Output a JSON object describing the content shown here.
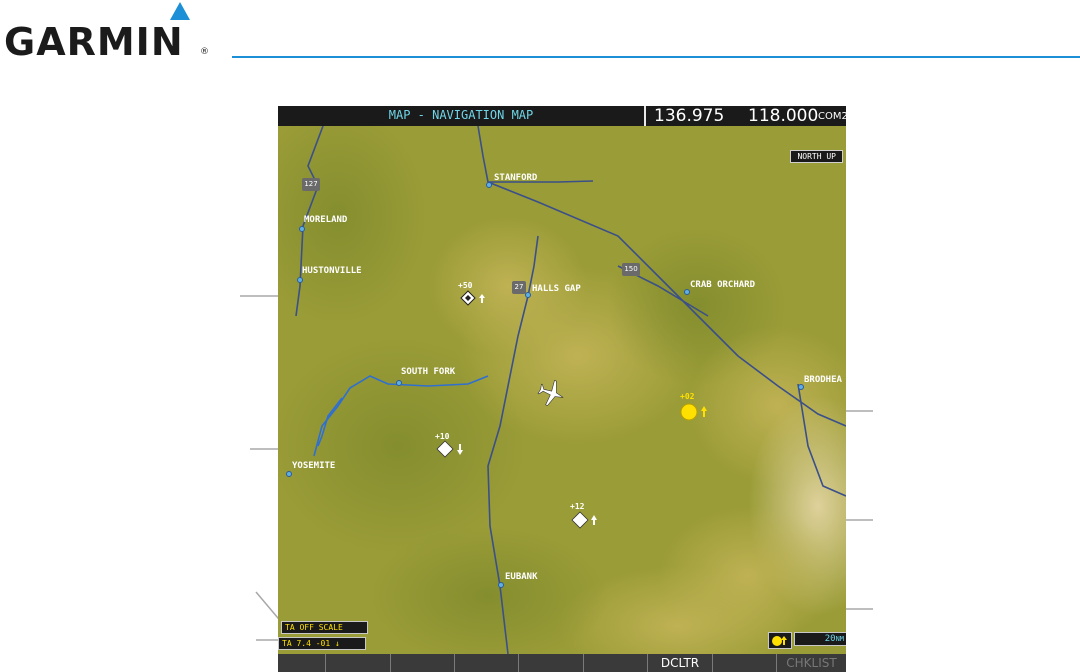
{
  "brand": {
    "name": "GARMIN",
    "mark": "®"
  },
  "header": {
    "title": "MAP - NAVIGATION MAP",
    "standby_freq": "136.975",
    "active_freq": "118.000",
    "com_label": "COM2"
  },
  "map": {
    "orientation": "NORTH UP",
    "towns": [
      {
        "label": "STANFORD"
      },
      {
        "label": "MORELAND"
      },
      {
        "label": "HUSTONVILLE"
      },
      {
        "label": "HALLS GAP"
      },
      {
        "label": "CRAB ORCHARD"
      },
      {
        "label": "SOUTH FORK"
      },
      {
        "label": "BRODHEA"
      },
      {
        "label": "YOSEMITE"
      },
      {
        "label": "EUBANK"
      }
    ],
    "highways": [
      "127",
      "27",
      "150"
    ],
    "traffic": [
      {
        "altitude": "+50",
        "trend": "up",
        "type": "proximate"
      },
      {
        "altitude": "+10",
        "trend": "down",
        "type": "other"
      },
      {
        "altitude": "+02",
        "trend": "up",
        "type": "advisory"
      },
      {
        "altitude": "+12",
        "trend": "up",
        "type": "other"
      }
    ],
    "ta_off_scale": "TA OFF SCALE",
    "ta_info": "TA 7.4 -01",
    "range_value": "20",
    "range_unit": "NM"
  },
  "softkeys": [
    "",
    "",
    "",
    "",
    "",
    "",
    "DCLTR",
    "",
    "CHKLIST"
  ],
  "colors": {
    "accent": "#1c8fd6",
    "title_cyan": "#6fd6e8",
    "traffic_yellow": "#ffe000",
    "terrain": "#9a9c37"
  }
}
